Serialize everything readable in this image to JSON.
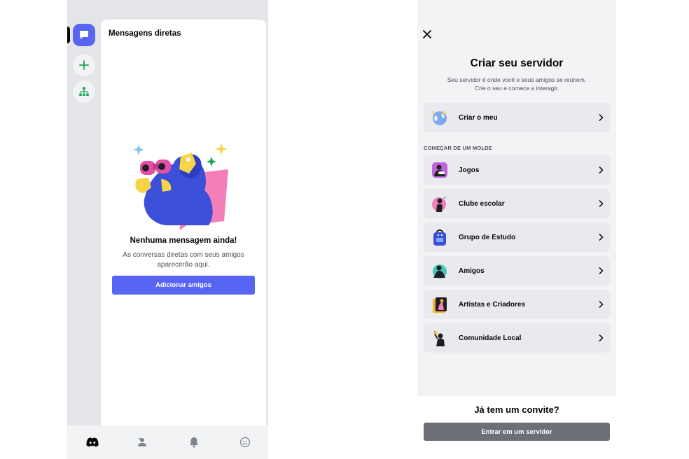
{
  "left": {
    "dm_header": "Mensagens diretas",
    "empty_title": "Nenhuma mensagem ainda!",
    "empty_desc_line1": "As conversas diretas com seus amigos",
    "empty_desc_line2": "aparecerão aqui.",
    "add_friends_button": "Adicionar amigos",
    "rail_icons": [
      "direct-messages-icon",
      "add-server-icon",
      "explore-servers-icon"
    ],
    "nav_icons": [
      "discord-home-icon",
      "friends-icon",
      "notifications-icon",
      "profile-icon"
    ]
  },
  "right": {
    "title": "Criar seu servidor",
    "subtitle_line1": "Seu servidor é onde você e seus amigos se reúnem.",
    "subtitle_line2": "Crie o seu e comece a interagir.",
    "create_own_label": "Criar o meu",
    "section_label": "COMEÇAR DE UM MOLDE",
    "templates": [
      {
        "label": "Jogos",
        "icon": "gaming-icon"
      },
      {
        "label": "Clube escolar",
        "icon": "school-club-icon"
      },
      {
        "label": "Grupo de Estudo",
        "icon": "study-group-icon"
      },
      {
        "label": "Amigos",
        "icon": "friends-icon"
      },
      {
        "label": "Artistas e Criadores",
        "icon": "artists-icon"
      },
      {
        "label": "Comunidade Local",
        "icon": "local-community-icon"
      }
    ],
    "invite_title": "Já tem um convite?",
    "join_button": "Entrar em um servidor"
  },
  "colors": {
    "blurple": "#5865f2",
    "green": "#23a55a",
    "gray_button": "#6d6f78"
  }
}
